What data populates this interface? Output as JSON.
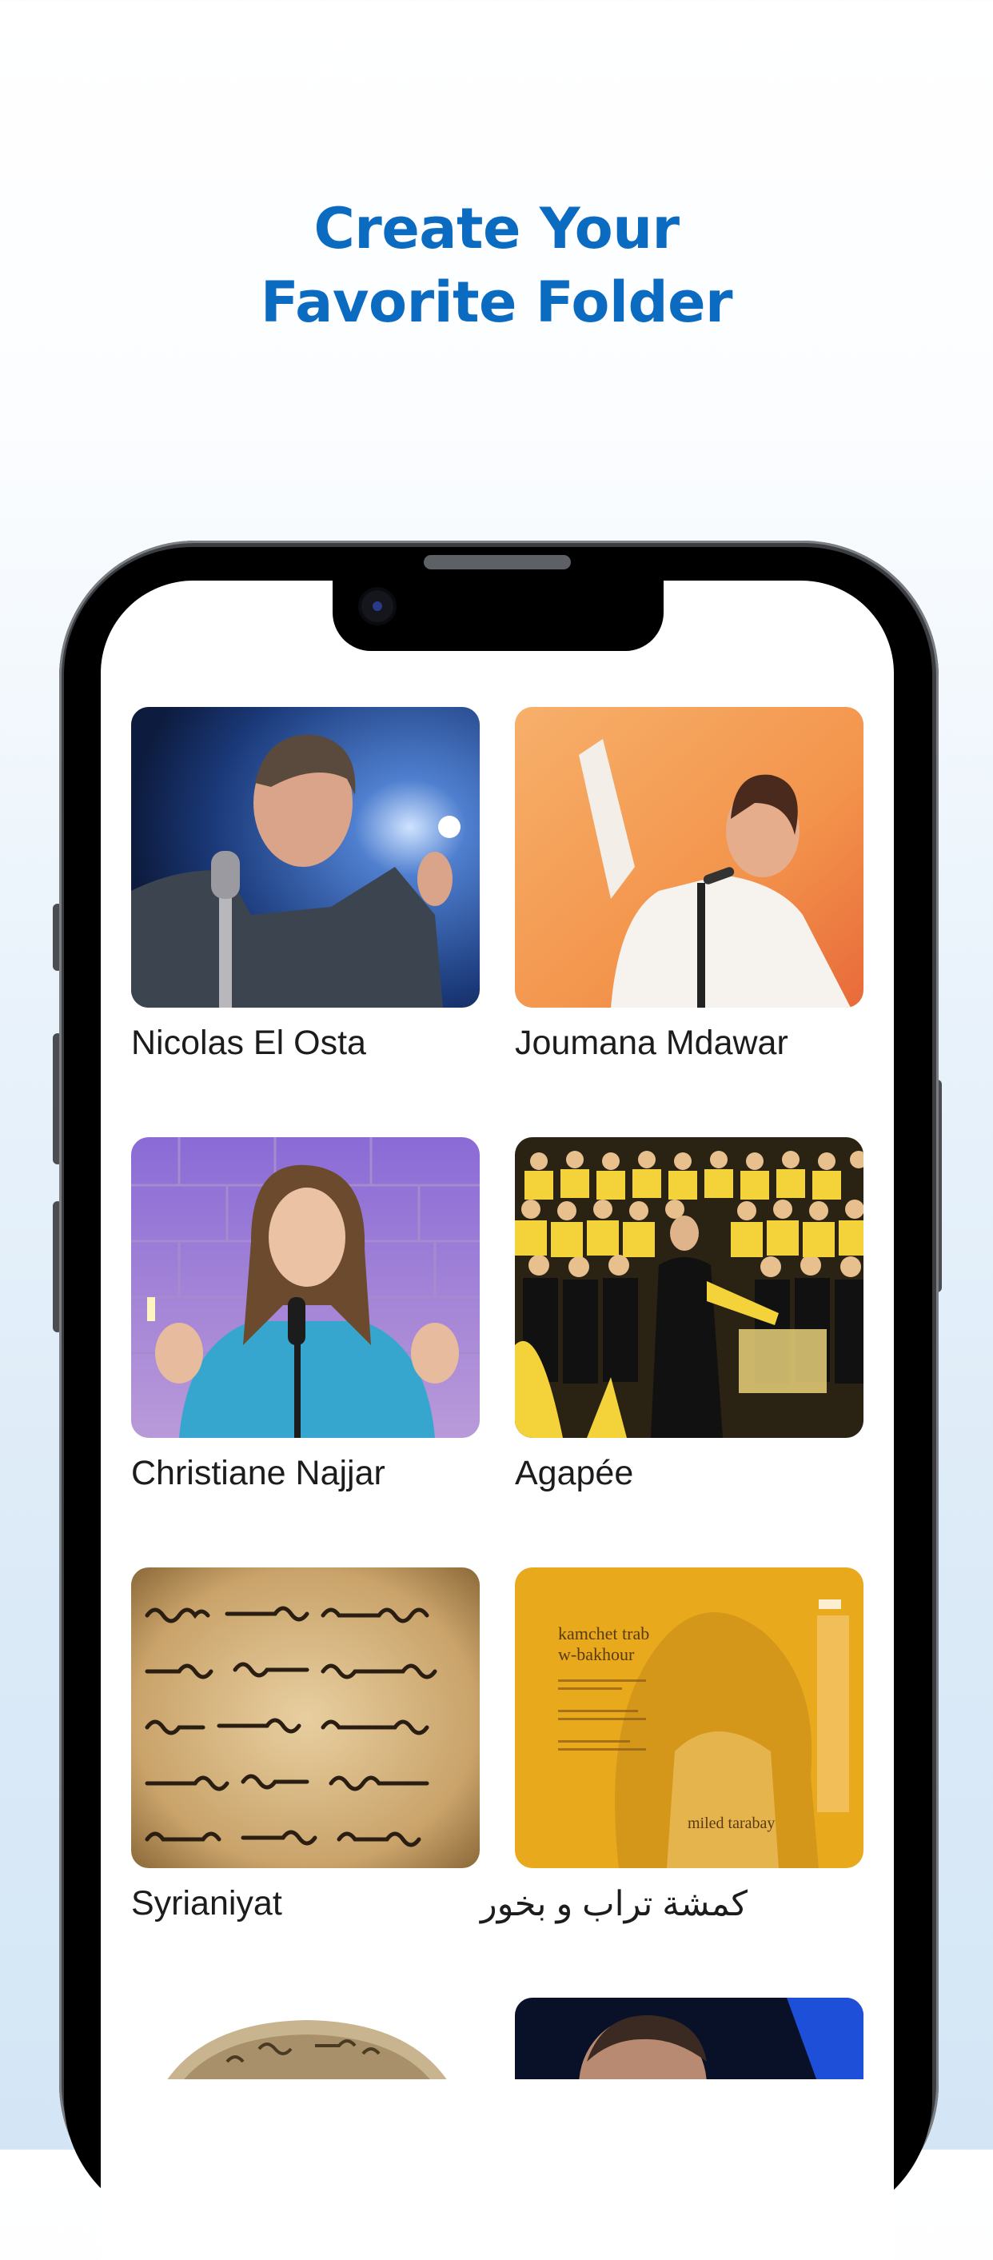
{
  "headline": {
    "line1": "Create Your",
    "line2": "Favorite Folder"
  },
  "folders": [
    {
      "title": "Nicolas El Osta"
    },
    {
      "title": "Joumana Mdawar"
    },
    {
      "title": "Christiane Najjar"
    },
    {
      "title": "Agapée"
    },
    {
      "title": "Syrianiyat"
    },
    {
      "title": "كمشة تراب و بخور",
      "cover_text": [
        "kamchet trab",
        "w-bakhour",
        "miled tarabay"
      ]
    },
    {
      "title": ""
    },
    {
      "title": ""
    }
  ],
  "colors": {
    "headline": "#0a6bc0",
    "label": "#1c1c1e"
  }
}
